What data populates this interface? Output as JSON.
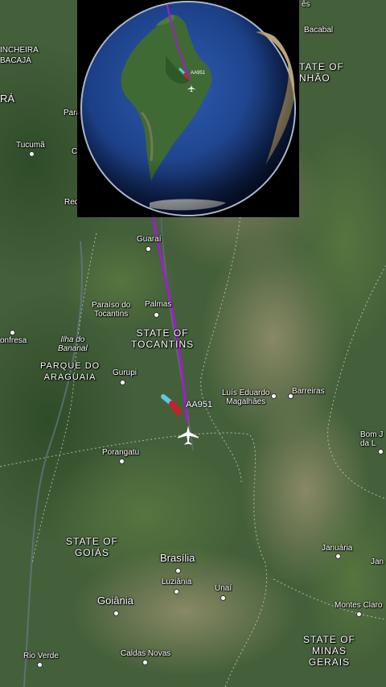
{
  "flight": {
    "callsign": "AA951",
    "track_color": "#a21bd1",
    "trail_colors": [
      "#5bc8e8",
      "#c8202a"
    ]
  },
  "labels": {
    "cinheira": "INCHEIRA",
    "bacaja": "BACAJÁ",
    "ra": "RÁ",
    "tucuma": "Tucumã",
    "para": "Para",
    "c": "C",
    "red": "Red",
    "bacabal": "Bacabal",
    "state_of": "TATE OF",
    "nhao": "NHÃO",
    "es": "ês",
    "guarai": "Guaraí",
    "paraiso": "Paraíso do\nTocantins",
    "palmas": "Palmas",
    "tocantins_state": "STATE OF\nTOCANTINS",
    "confresa": "onfresa",
    "ilha": "Ilha do\nBananal",
    "parque": "PARQUE DO\nARAGUAIA",
    "gurupi": "Gurupi",
    "luis_eduardo": "Luís Eduardo\nMagalhães",
    "barreiras": "Barreiras",
    "bom_jesus": "Bom J\nda L",
    "porangatu": "Porangatu",
    "goias_state": "STATE OF\nGOIÁS",
    "brasilia": "Brasília",
    "luziania": "Luziânia",
    "unai": "Unaí",
    "januaria": "Januária",
    "jan": "Jan",
    "goiania": "Goiânia",
    "montes_claros": "Montes Claro",
    "rio_verde": "Rio Verde",
    "caldas_novas": "Caldas Novas",
    "minas_state": "STATE OF\nMINAS\nGERAIS"
  },
  "inset_globe": {
    "flight_label": "AA951"
  },
  "colors": {
    "ocean": "#1c3f86",
    "land": "#3f6a34",
    "space": "#000000"
  }
}
